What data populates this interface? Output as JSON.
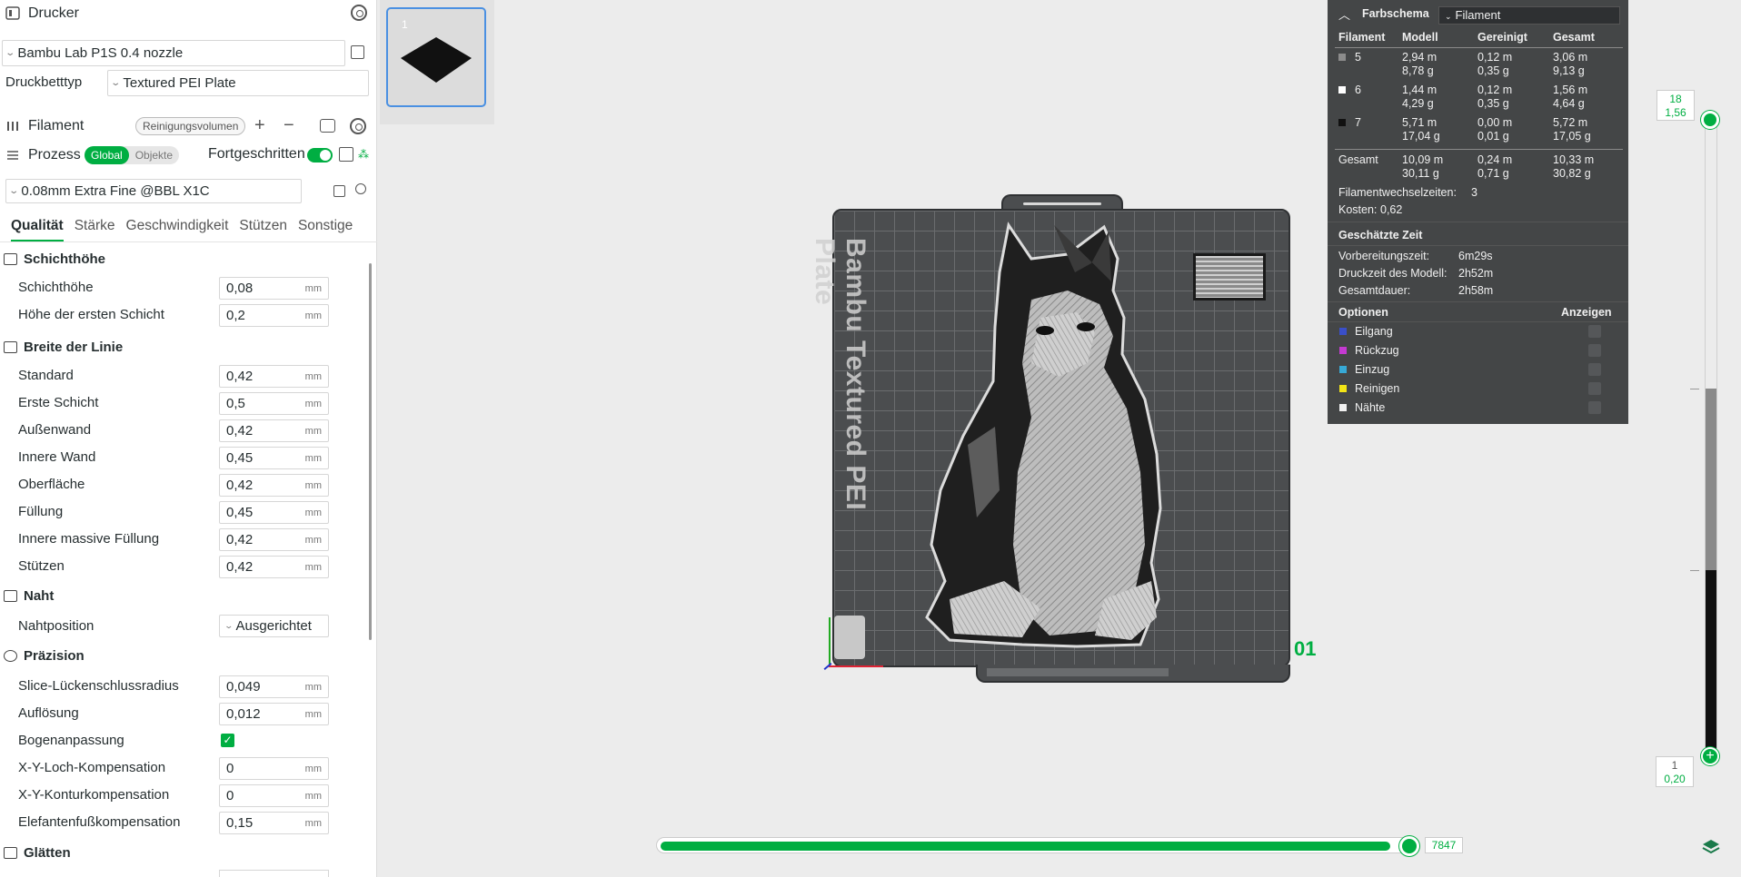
{
  "printer": {
    "section_label": "Drucker",
    "printer_name": "Bambu Lab P1S 0.4 nozzle",
    "bed_type_label": "Druckbetttyp",
    "bed_type_value": "Textured PEI Plate"
  },
  "filament": {
    "section_label": "Filament",
    "flush_button": "Reinigungsvolumen",
    "add_symbol": "+",
    "remove_symbol": "−"
  },
  "process": {
    "section_label": "Prozess",
    "global_label": "Global",
    "objects_label": "Objekte",
    "advanced_label": "Fortgeschritten",
    "advanced_on": true,
    "preset": "0.08mm Extra Fine @BBL X1C"
  },
  "tabs": [
    "Qualität",
    "Stärke",
    "Geschwindigkeit",
    "Stützen",
    "Sonstige"
  ],
  "unit": "mm",
  "groups": {
    "layer_height": {
      "title": "Schichthöhe",
      "rows": [
        {
          "label": "Schichthöhe",
          "value": "0,08"
        },
        {
          "label": "Höhe der ersten Schicht",
          "value": "0,2"
        }
      ]
    },
    "line_width": {
      "title": "Breite der Linie",
      "rows": [
        {
          "label": "Standard",
          "value": "0,42"
        },
        {
          "label": "Erste Schicht",
          "value": "0,5"
        },
        {
          "label": "Außenwand",
          "value": "0,42"
        },
        {
          "label": "Innere Wand",
          "value": "0,45"
        },
        {
          "label": "Oberfläche",
          "value": "0,42"
        },
        {
          "label": "Füllung",
          "value": "0,45"
        },
        {
          "label": "Innere massive Füllung",
          "value": "0,42"
        },
        {
          "label": "Stützen",
          "value": "0,42"
        }
      ]
    },
    "seam": {
      "title": "Naht",
      "rows": [
        {
          "label": "Nahtposition",
          "value": "Ausgerichtet"
        }
      ]
    },
    "precision": {
      "title": "Präzision",
      "rows": [
        {
          "label": "Slice-Lückenschlussradius",
          "value": "0,049"
        },
        {
          "label": "Auflösung",
          "value": "0,012"
        },
        {
          "label": "Bogenanpassung",
          "value": ""
        },
        {
          "label": "X-Y-Loch-Kompensation",
          "value": "0"
        },
        {
          "label": "X-Y-Konturkompensation",
          "value": "0"
        },
        {
          "label": "Elefantenfußkompensation",
          "value": "0,15"
        }
      ]
    },
    "ironing": {
      "title": "Glätten"
    }
  },
  "plate": {
    "number": "1",
    "bed_text": "Bambu Textured PEI Plate",
    "plate_index": "01"
  },
  "stats": {
    "color_scheme_label": "Farbschema",
    "color_scheme_value": "Filament",
    "headers": [
      "Filament",
      "Modell",
      "Gereinigt",
      "Gesamt"
    ],
    "rows": [
      {
        "id": "5",
        "color": "#8c8c8c",
        "model_m": "2,94 m",
        "model_g": "8,78 g",
        "flushed_m": "0,12 m",
        "flushed_g": "0,35 g",
        "total_m": "3,06 m",
        "total_g": "9,13 g"
      },
      {
        "id": "6",
        "color": "#ffffff",
        "model_m": "1,44 m",
        "model_g": "4,29 g",
        "flushed_m": "0,12 m",
        "flushed_g": "0,35 g",
        "total_m": "1,56 m",
        "total_g": "4,64 g"
      },
      {
        "id": "7",
        "color": "#111111",
        "model_m": "5,71 m",
        "model_g": "17,04 g",
        "flushed_m": "0,00 m",
        "flushed_g": "0,01 g",
        "total_m": "5,72 m",
        "total_g": "17,05 g"
      }
    ],
    "total": {
      "label": "Gesamt",
      "model_m": "10,09 m",
      "model_g": "30,11 g",
      "flushed_m": "0,24 m",
      "flushed_g": "0,71 g",
      "total_m": "10,33 m",
      "total_g": "30,82 g"
    },
    "changes_label": "Filamentwechselzeiten:",
    "changes_value": "3",
    "cost_label": "Kosten:",
    "cost_value": "0,62",
    "time_title": "Geschätzte Zeit",
    "prep_label": "Vorbereitungszeit:",
    "prep_value": "6m29s",
    "model_time_label": "Druckzeit des Modell:",
    "model_time_value": "2h52m",
    "total_time_label": "Gesamtdauer:",
    "total_time_value": "2h58m",
    "options_label": "Optionen",
    "show_label": "Anzeigen",
    "options": [
      {
        "label": "Eilgang",
        "color": "#3a4fc9"
      },
      {
        "label": "Rückzug",
        "color": "#c43ad1"
      },
      {
        "label": "Einzug",
        "color": "#37a9d6"
      },
      {
        "label": "Reinigen",
        "color": "#f2e416"
      },
      {
        "label": "Nähte",
        "color": "#f0f0f0"
      }
    ]
  },
  "layer_slider": {
    "top_layer": "18",
    "top_height": "1,56",
    "bottom_layer": "1",
    "bottom_height": "0,20"
  },
  "move_slider": {
    "value": "7847"
  },
  "colors": {
    "accent": "#00ae42",
    "selection": "#4a90e2"
  }
}
